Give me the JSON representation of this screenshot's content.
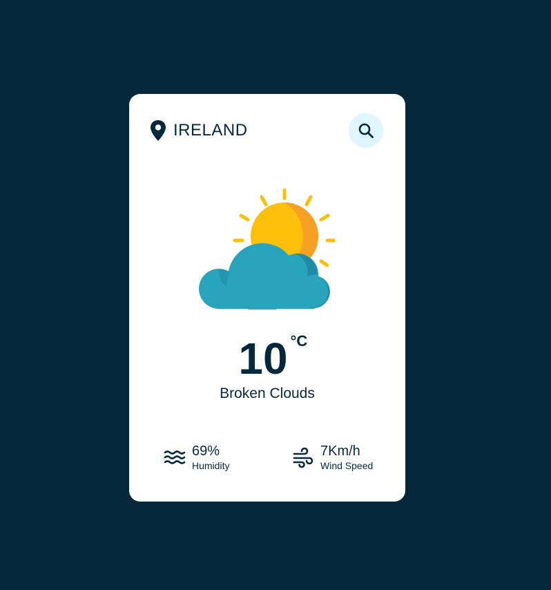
{
  "location": {
    "name": "IRELAND",
    "icon": "map-pin-icon"
  },
  "search": {
    "icon": "search-icon"
  },
  "weather": {
    "icon": "sun-behind-cloud-icon",
    "temperature": "10",
    "unit": "°C",
    "description": "Broken Clouds"
  },
  "details": {
    "humidity": {
      "value": "69%",
      "label": "Humidity",
      "icon": "water-waves-icon"
    },
    "wind": {
      "value": "7Km/h",
      "label": "Wind Speed",
      "icon": "wind-icon"
    }
  },
  "colors": {
    "background": "#06283d",
    "card": "#ffffff",
    "text": "#06283d",
    "search_button": "#dff6ff",
    "sun": "#fcbf0c",
    "sun_shade": "#f6a024",
    "cloud": "#28a5bd",
    "cloud_shade": "#1e8ca5"
  }
}
